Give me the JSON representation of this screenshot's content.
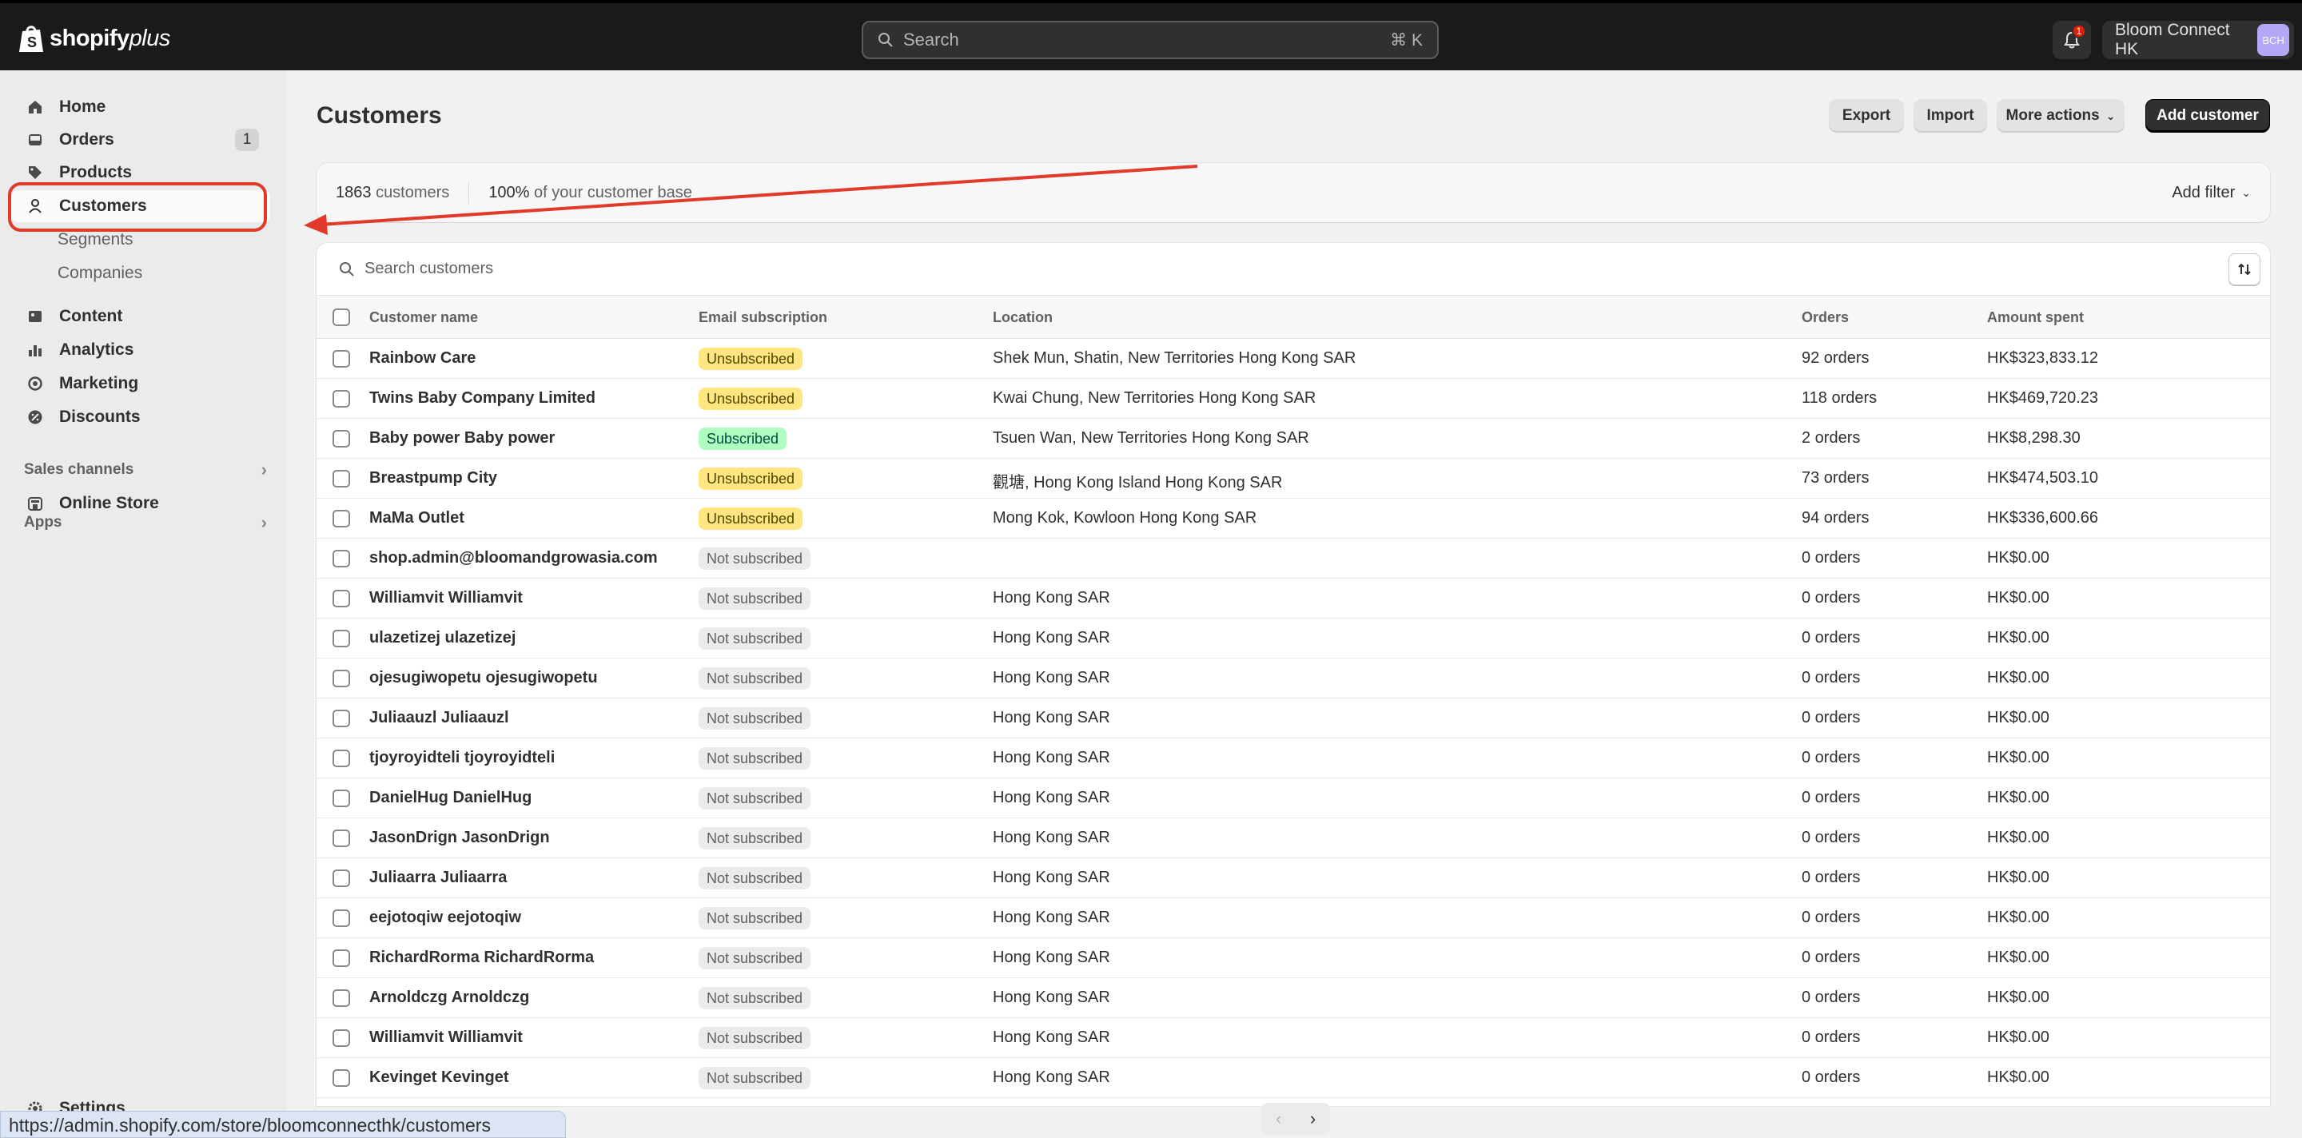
{
  "topbar": {
    "logo_text_bold": "shopify",
    "logo_text_italic": "plus",
    "search_placeholder": "Search",
    "search_shortcut": "⌘ K",
    "notification_count": "1",
    "store_name": "Bloom Connect HK",
    "store_avatar": "BCH"
  },
  "sidebar": {
    "items": [
      {
        "label": "Home",
        "icon": "home-icon"
      },
      {
        "label": "Orders",
        "icon": "inbox-icon",
        "count": "1"
      },
      {
        "label": "Products",
        "icon": "tag-icon"
      },
      {
        "label": "Customers",
        "icon": "person-icon",
        "active": true
      },
      {
        "label": "Segments"
      },
      {
        "label": "Companies"
      },
      {
        "label": "Content",
        "icon": "image-icon"
      },
      {
        "label": "Analytics",
        "icon": "bar-chart-icon"
      },
      {
        "label": "Marketing",
        "icon": "target-icon"
      },
      {
        "label": "Discounts",
        "icon": "discount-icon"
      }
    ],
    "sales_channels": "Sales channels",
    "online_store": "Online Store",
    "apps": "Apps",
    "settings": "Settings"
  },
  "status_url": "https://admin.shopify.com/store/bloomconnecthk/customers",
  "page": {
    "title": "Customers",
    "buttons": {
      "export": "Export",
      "import": "Import",
      "more_actions": "More actions",
      "add_customer": "Add customer"
    }
  },
  "stats": {
    "count": "1863",
    "count_label": "customers",
    "percent": "100%",
    "percent_label": "of your customer base",
    "add_filter": "Add filter"
  },
  "table": {
    "search_placeholder": "Search customers",
    "headers": [
      "Customer name",
      "Email subscription",
      "Location",
      "Orders",
      "Amount spent"
    ],
    "rows": [
      {
        "name": "Rainbow Care",
        "sub": "Unsubscribed",
        "status": "unsub",
        "loc": "Shek Mun, Shatin, New Territories Hong Kong SAR",
        "orders": "92 orders",
        "amount": "HK$323,833.12"
      },
      {
        "name": "Twins Baby Company Limited",
        "sub": "Unsubscribed",
        "status": "unsub",
        "loc": "Kwai Chung, New Territories Hong Kong SAR",
        "orders": "118 orders",
        "amount": "HK$469,720.23"
      },
      {
        "name": "Baby power Baby power",
        "sub": "Subscribed",
        "status": "sub",
        "loc": "Tsuen Wan, New Territories Hong Kong SAR",
        "orders": "2 orders",
        "amount": "HK$8,298.30"
      },
      {
        "name": "Breastpump City",
        "sub": "Unsubscribed",
        "status": "unsub",
        "loc": "觀塘, Hong Kong Island Hong Kong SAR",
        "orders": "73 orders",
        "amount": "HK$474,503.10"
      },
      {
        "name": "MaMa Outlet",
        "sub": "Unsubscribed",
        "status": "unsub",
        "loc": "Mong Kok, Kowloon Hong Kong SAR",
        "orders": "94 orders",
        "amount": "HK$336,600.66"
      },
      {
        "name": "shop.admin@bloomandgrowasia.com",
        "sub": "Not subscribed",
        "status": "not",
        "loc": "",
        "orders": "0 orders",
        "amount": "HK$0.00"
      },
      {
        "name": "Williamvit Williamvit",
        "sub": "Not subscribed",
        "status": "not",
        "loc": "Hong Kong SAR",
        "orders": "0 orders",
        "amount": "HK$0.00"
      },
      {
        "name": "ulazetizej ulazetizej",
        "sub": "Not subscribed",
        "status": "not",
        "loc": "Hong Kong SAR",
        "orders": "0 orders",
        "amount": "HK$0.00"
      },
      {
        "name": "ojesugiwopetu ojesugiwopetu",
        "sub": "Not subscribed",
        "status": "not",
        "loc": "Hong Kong SAR",
        "orders": "0 orders",
        "amount": "HK$0.00"
      },
      {
        "name": "Juliaauzl Juliaauzl",
        "sub": "Not subscribed",
        "status": "not",
        "loc": "Hong Kong SAR",
        "orders": "0 orders",
        "amount": "HK$0.00"
      },
      {
        "name": "tjoyroyidteli tjoyroyidteli",
        "sub": "Not subscribed",
        "status": "not",
        "loc": "Hong Kong SAR",
        "orders": "0 orders",
        "amount": "HK$0.00"
      },
      {
        "name": "DanielHug DanielHug",
        "sub": "Not subscribed",
        "status": "not",
        "loc": "Hong Kong SAR",
        "orders": "0 orders",
        "amount": "HK$0.00"
      },
      {
        "name": "JasonDrign JasonDrign",
        "sub": "Not subscribed",
        "status": "not",
        "loc": "Hong Kong SAR",
        "orders": "0 orders",
        "amount": "HK$0.00"
      },
      {
        "name": "Juliaarra Juliaarra",
        "sub": "Not subscribed",
        "status": "not",
        "loc": "Hong Kong SAR",
        "orders": "0 orders",
        "amount": "HK$0.00"
      },
      {
        "name": "eejotoqiw eejotoqiw",
        "sub": "Not subscribed",
        "status": "not",
        "loc": "Hong Kong SAR",
        "orders": "0 orders",
        "amount": "HK$0.00"
      },
      {
        "name": "RichardRorma RichardRorma",
        "sub": "Not subscribed",
        "status": "not",
        "loc": "Hong Kong SAR",
        "orders": "0 orders",
        "amount": "HK$0.00"
      },
      {
        "name": "Arnoldczg Arnoldczg",
        "sub": "Not subscribed",
        "status": "not",
        "loc": "Hong Kong SAR",
        "orders": "0 orders",
        "amount": "HK$0.00"
      },
      {
        "name": "Williamvit Williamvit",
        "sub": "Not subscribed",
        "status": "not",
        "loc": "Hong Kong SAR",
        "orders": "0 orders",
        "amount": "HK$0.00"
      },
      {
        "name": "Kevinget Kevinget",
        "sub": "Not subscribed",
        "status": "not",
        "loc": "Hong Kong SAR",
        "orders": "0 orders",
        "amount": "HK$0.00"
      }
    ]
  },
  "colors": {
    "annotation_red": "#e23a2a",
    "topbar": "#1a1a1a"
  }
}
